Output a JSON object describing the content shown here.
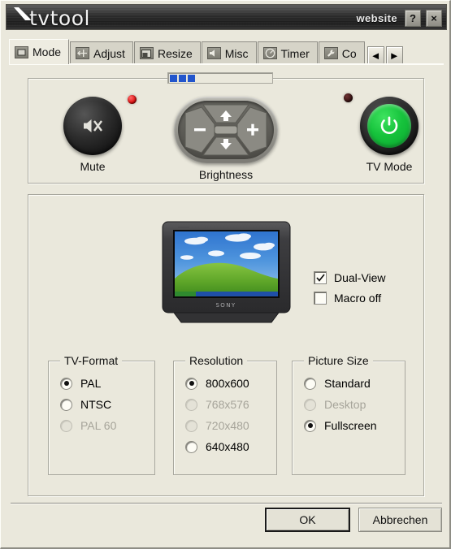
{
  "window": {
    "app_title": "tvtool"
  },
  "titlebar": {
    "website_label": "website",
    "help_label": "?",
    "close_label": "×"
  },
  "tabs": [
    {
      "label": "Mode",
      "icon": "monitor-icon",
      "active": true
    },
    {
      "label": "Adjust",
      "icon": "arrows-icon",
      "active": false
    },
    {
      "label": "Resize",
      "icon": "resize-icon",
      "active": false
    },
    {
      "label": "Misc",
      "icon": "speaker-icon",
      "active": false
    },
    {
      "label": "Timer",
      "icon": "gauge-icon",
      "active": false
    },
    {
      "label": "Co",
      "icon": "wrench-icon",
      "active": false
    }
  ],
  "tab_nav": {
    "prev_label": "◄",
    "next_label": "►"
  },
  "progress": {
    "blocks_filled": 3
  },
  "controls": {
    "mute": {
      "label": "Mute",
      "icon": "mute-icon",
      "led": "on",
      "led_color": "#e01010"
    },
    "bright": {
      "label": "Brightness",
      "icon": "dpad-icon",
      "up_label": "▲",
      "down_label": "▼",
      "minus_label": "−",
      "plus_label": "+"
    },
    "tvmode": {
      "label": "TV Mode",
      "icon": "power-icon",
      "led": "off",
      "led_color": "#3a1414",
      "button_color": "#16c33c"
    }
  },
  "preview": {
    "device": "sony-crt-tv",
    "brand": "SONY",
    "wallpaper": "windows-xp-bliss"
  },
  "checkboxes": [
    {
      "label": "Dual-View",
      "checked": true
    },
    {
      "label": "Macro off",
      "checked": false
    }
  ],
  "groups": [
    {
      "title": "TV-Format",
      "options": [
        {
          "label": "PAL",
          "selected": true,
          "disabled": false
        },
        {
          "label": "NTSC",
          "selected": false,
          "disabled": false
        },
        {
          "label": "PAL 60",
          "selected": false,
          "disabled": true
        }
      ]
    },
    {
      "title": "Resolution",
      "options": [
        {
          "label": "800x600",
          "selected": true,
          "disabled": false
        },
        {
          "label": "768x576",
          "selected": false,
          "disabled": true
        },
        {
          "label": "720x480",
          "selected": false,
          "disabled": true
        },
        {
          "label": "640x480",
          "selected": false,
          "disabled": false
        }
      ]
    },
    {
      "title": "Picture Size",
      "options": [
        {
          "label": "Standard",
          "selected": false,
          "disabled": false
        },
        {
          "label": "Desktop",
          "selected": false,
          "disabled": true
        },
        {
          "label": "Fullscreen",
          "selected": true,
          "disabled": false
        }
      ]
    }
  ],
  "footer": {
    "ok_label": "OK",
    "cancel_label": "Abbrechen"
  }
}
